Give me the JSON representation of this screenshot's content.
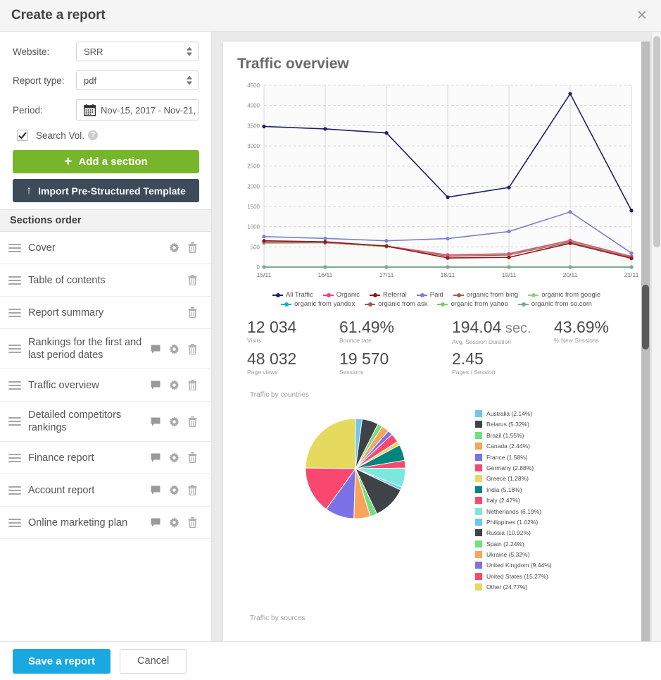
{
  "window": {
    "title": "Create a report",
    "close_label": "✕"
  },
  "form": {
    "website_label": "Website:",
    "website_value": "SRR",
    "report_type_label": "Report type:",
    "report_type_value": "pdf",
    "period_label": "Period:",
    "period_value": "Nov-15, 2017 - Nov-21, 201",
    "search_vol_label": "Search Vol.",
    "help_glyph": "?",
    "add_section_label": "Add a section",
    "add_section_glyph": "+",
    "import_template_label": "Import Pre-Structured Template",
    "import_glyph": "↑"
  },
  "sections": {
    "header": "Sections order",
    "items": [
      {
        "label": "Cover",
        "comment": false,
        "gear": true,
        "trash": true
      },
      {
        "label": "Table of contents",
        "comment": false,
        "gear": false,
        "trash": true
      },
      {
        "label": "Report summary",
        "comment": false,
        "gear": false,
        "trash": true
      },
      {
        "label": "Rankings for the first and last period dates",
        "comment": true,
        "gear": true,
        "trash": true
      },
      {
        "label": "Traffic overview",
        "comment": true,
        "gear": true,
        "trash": true
      },
      {
        "label": "Detailed competitors rankings",
        "comment": true,
        "gear": true,
        "trash": true
      },
      {
        "label": "Finance report",
        "comment": true,
        "gear": true,
        "trash": true
      },
      {
        "label": "Account report",
        "comment": true,
        "gear": true,
        "trash": true
      },
      {
        "label": "Online marketing plan",
        "comment": true,
        "gear": true,
        "trash": true
      }
    ]
  },
  "preview": {
    "report_title": "Traffic overview",
    "caption_countries": "Traffic by countries",
    "caption_sources": "Traffic by sources",
    "kpis": [
      {
        "value": "12 034",
        "unit": "",
        "label": "Visits"
      },
      {
        "value": "61.49%",
        "unit": "",
        "label": "Bounce rate"
      },
      {
        "value": "194.04",
        "unit": " sec.",
        "label": "Avg. Session Duration"
      },
      {
        "value": "43.69%",
        "unit": "",
        "label": "% New Sessions"
      },
      {
        "value": "48 032",
        "unit": "",
        "label": "Page views"
      },
      {
        "value": "19 570",
        "unit": "",
        "label": "Sessions"
      },
      {
        "value": "2.45",
        "unit": "",
        "label": "Pages / Session"
      }
    ]
  },
  "footer": {
    "save_label": "Save a report",
    "cancel_label": "Cancel"
  },
  "colors": {
    "accent_green": "#77b52b",
    "accent_dark": "#3c4a59",
    "accent_blue": "#19a8e0"
  },
  "chart_data": [
    {
      "type": "line",
      "title": "Traffic overview",
      "xlabel": "",
      "ylabel": "",
      "grid": true,
      "legend_position": "bottom",
      "ylim": [
        0,
        4500
      ],
      "yticks": [
        0,
        500,
        1000,
        1500,
        2000,
        2500,
        3000,
        3500,
        4000,
        4500
      ],
      "categories": [
        "15/11",
        "16/11",
        "17/11",
        "18/11",
        "19/11",
        "20/11",
        "21/11"
      ],
      "series": [
        {
          "name": "All Traffic",
          "color": "#1f1f6e",
          "values": [
            3480,
            3420,
            3320,
            1730,
            1970,
            4290,
            1400
          ]
        },
        {
          "name": "Organic",
          "color": "#e8467f",
          "values": [
            620,
            610,
            520,
            300,
            330,
            660,
            260
          ]
        },
        {
          "name": "Referral",
          "color": "#8e1b1b",
          "values": [
            650,
            625,
            520,
            225,
            240,
            590,
            215
          ]
        },
        {
          "name": "Paid",
          "color": "#7f7fcb",
          "values": [
            755,
            710,
            650,
            705,
            880,
            1365,
            345
          ]
        },
        {
          "name": "organic from bing",
          "color": "#a85b4e",
          "values": [
            610,
            600,
            510,
            270,
            300,
            620,
            240
          ]
        },
        {
          "name": "organic from google",
          "color": "#8cd17d",
          "values": [
            585,
            600,
            505,
            290,
            320,
            640,
            255
          ]
        },
        {
          "name": "organic from yandex",
          "color": "#11b0cc",
          "values": [
            0,
            0,
            0,
            0,
            0,
            0,
            0
          ]
        },
        {
          "name": "organic from ask",
          "color": "#a8564a",
          "values": [
            0,
            0,
            0,
            0,
            0,
            0,
            0
          ]
        },
        {
          "name": "organic from yahoo",
          "color": "#6fd45f",
          "values": [
            0,
            0,
            0,
            0,
            0,
            0,
            0
          ]
        },
        {
          "name": "organic from so.com",
          "color": "#7fa899",
          "values": [
            0,
            0,
            0,
            0,
            0,
            0,
            0
          ]
        }
      ]
    },
    {
      "type": "pie",
      "title": "Traffic by countries",
      "legend_position": "right",
      "slices": [
        {
          "label": "Australia (2.14%)",
          "value": 2.14,
          "color": "#6ec6f0"
        },
        {
          "label": "Belarus (5.32%)",
          "value": 5.32,
          "color": "#3f4247"
        },
        {
          "label": "Brazil (1.55%)",
          "value": 1.55,
          "color": "#72e07e"
        },
        {
          "label": "Canada (2.44%)",
          "value": 2.44,
          "color": "#f9a45c"
        },
        {
          "label": "France (1.58%)",
          "value": 1.58,
          "color": "#7b72e8"
        },
        {
          "label": "Germany (2.88%)",
          "value": 2.88,
          "color": "#f9486f"
        },
        {
          "label": "Greece (1.28%)",
          "value": 1.28,
          "color": "#e5d95e"
        },
        {
          "label": "India (5.18%)",
          "value": 5.18,
          "color": "#00857f"
        },
        {
          "label": "Italy (2.47%)",
          "value": 2.47,
          "color": "#f9486f"
        },
        {
          "label": "Netherlands (6.19%)",
          "value": 6.19,
          "color": "#7ae8dd"
        },
        {
          "label": "Philippines (1.02%)",
          "value": 1.02,
          "color": "#6ec6f0"
        },
        {
          "label": "Russia (10.92%)",
          "value": 10.92,
          "color": "#3f4247"
        },
        {
          "label": "Spain (2.24%)",
          "value": 2.24,
          "color": "#72e07e"
        },
        {
          "label": "Ukraine (5.32%)",
          "value": 5.32,
          "color": "#f9a45c"
        },
        {
          "label": "United Kingdom (9.44%)",
          "value": 9.44,
          "color": "#7b72e8"
        },
        {
          "label": "United States (15.27%)",
          "value": 15.27,
          "color": "#f9486f"
        },
        {
          "label": "Other (24.77%)",
          "value": 24.77,
          "color": "#e5d95e"
        }
      ]
    }
  ]
}
